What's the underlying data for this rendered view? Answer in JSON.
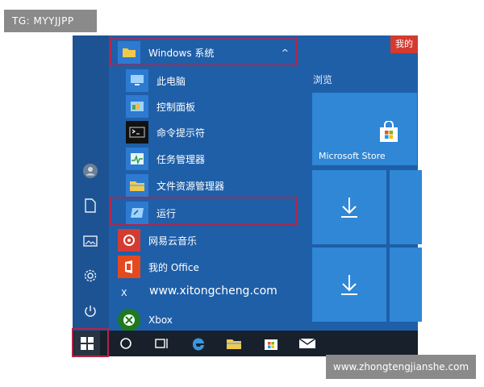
{
  "watermark_top": "TG: MYYJJPP",
  "watermark_bottom": "www.zhongtengjianshe.com",
  "group": {
    "label": "Windows 系统",
    "chevron": "^"
  },
  "items": [
    {
      "label": "此电脑",
      "icon": "computer-icon"
    },
    {
      "label": "控制面板",
      "icon": "control-panel-icon"
    },
    {
      "label": "命令提示符",
      "icon": "cmd-icon"
    },
    {
      "label": "任务管理器",
      "icon": "task-manager-icon"
    },
    {
      "label": "文件资源管理器",
      "icon": "file-explorer-icon"
    },
    {
      "label": "运行",
      "icon": "run-icon"
    },
    {
      "label": "网易云音乐",
      "icon": "netease-music-icon"
    },
    {
      "label": "我的 Office",
      "icon": "office-icon"
    }
  ],
  "section_x": {
    "letter": "X",
    "url_text": "www.xitongcheng.com"
  },
  "xbox": {
    "label": "Xbox"
  },
  "right_panel": {
    "top_tile_label": "我的",
    "section_label": "浏览",
    "store_label": "Microsoft Store"
  },
  "colors": {
    "start_bg": "#1f5fa8",
    "tile_bg": "#2f87d6",
    "highlight": "#b3244a",
    "taskbar": "#18212b"
  }
}
